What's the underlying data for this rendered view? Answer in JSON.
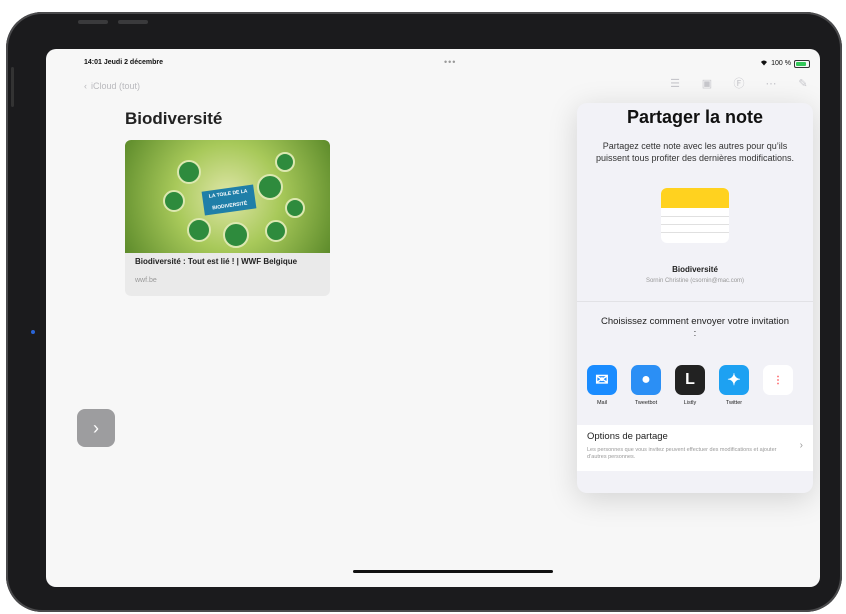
{
  "status_bar": {
    "time": "14:01",
    "date": "Jeudi 2 décembre",
    "dots": "•••",
    "battery_text": "100 %"
  },
  "navigation": {
    "back_label": "iCloud (tout)"
  },
  "note": {
    "title": "Biodiversité",
    "link_card": {
      "title": "Biodiversité : Tout est lié ! | WWF Belgique",
      "domain": "wwf.be",
      "banner_text": "LA TOILE DE LA BIODIVERSITÉ"
    }
  },
  "share_sheet": {
    "title": "Partager la note",
    "description": "Partagez cette note avec les autres pour qu’ils puissent tous profiter des dernières modifications.",
    "document_name": "Biodiversité",
    "owner": "Sornin Christine (csornin@mac.com)",
    "invite_prompt": "Choisissez comment envoyer votre invitation :",
    "apps": [
      {
        "label": "Mail",
        "icon": "mail-icon",
        "color": "#1a8cff"
      },
      {
        "label": "Tweetbot",
        "icon": "tweetbot-icon",
        "color": "#2b8ff5"
      },
      {
        "label": "Listly",
        "icon": "listly-icon",
        "color": "#222222"
      },
      {
        "label": "Twitter",
        "icon": "twitter-icon",
        "color": "#1da1f2"
      }
    ],
    "options": {
      "title": "Options de partage",
      "description": "Les personnes que vous invitez peuvent effectuer des modifications et ajouter d’autres personnes."
    }
  }
}
